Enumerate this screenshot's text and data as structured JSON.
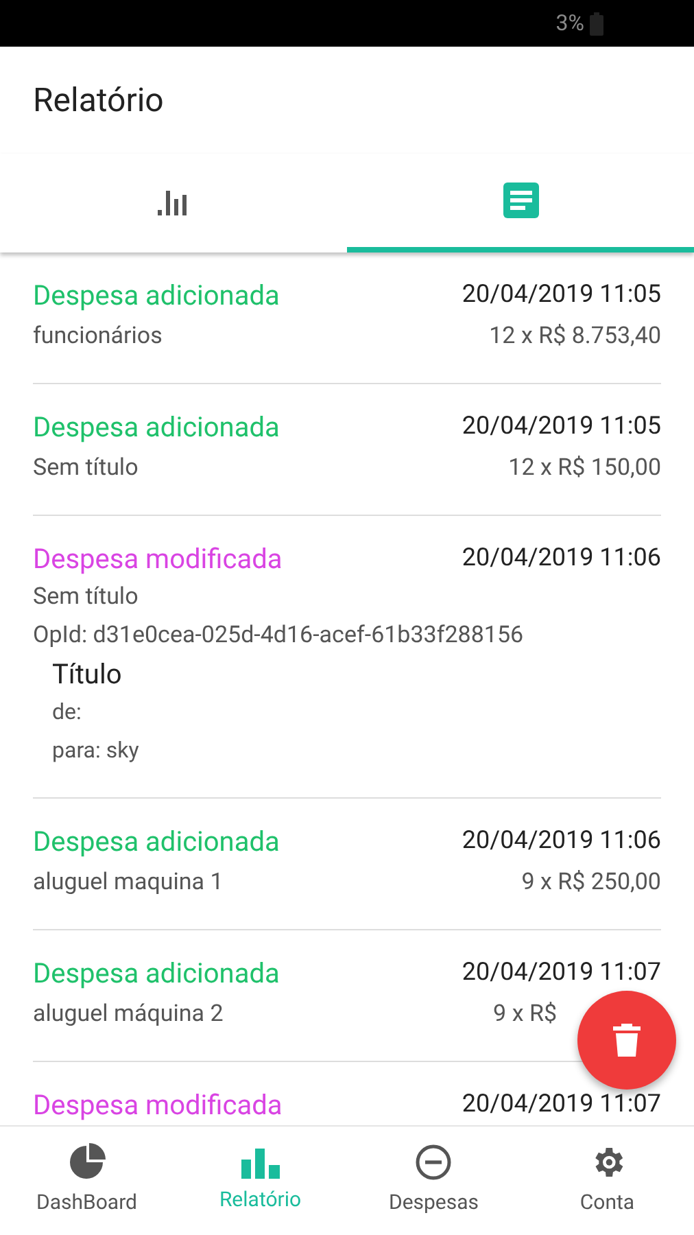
{
  "status_bar": {
    "battery": "3%"
  },
  "app_bar": {
    "title": "Relatório"
  },
  "tabs": [
    {
      "kind": "chart",
      "selected": false
    },
    {
      "kind": "list",
      "selected": true
    }
  ],
  "entries": [
    {
      "kind": "added",
      "title": "Despesa adicionada",
      "date": "20/04/2019 11:05",
      "subtitle": "funcionários",
      "amount": "12 x R$ 8.753,40"
    },
    {
      "kind": "added",
      "title": "Despesa adicionada",
      "date": "20/04/2019 11:05",
      "subtitle": "Sem título",
      "amount": "12 x R$ 150,00"
    },
    {
      "kind": "modified",
      "title": "Despesa modificada",
      "date": "20/04/2019 11:06",
      "subtitle": "Sem título",
      "op_id": "OpId: d31e0cea-025d-4d16-acef-61b33f288156",
      "change": {
        "field": "Título",
        "from": "de:",
        "to": "para: sky"
      }
    },
    {
      "kind": "added",
      "title": "Despesa adicionada",
      "date": "20/04/2019 11:06",
      "subtitle": "aluguel maquina 1",
      "amount": "9 x R$ 250,00"
    },
    {
      "kind": "added",
      "title": "Despesa adicionada",
      "date": "20/04/2019 11:07",
      "subtitle": "aluguel máquina 2",
      "amount": "9 x R$",
      "covered_by_button": true
    },
    {
      "kind": "modified",
      "title": "Despesa modificada",
      "date": "20/04/2019 11:07"
    }
  ],
  "bottom_nav": [
    {
      "kind": "dashboard",
      "label": "DashBoard",
      "selected": false
    },
    {
      "kind": "report",
      "label": "Relatório",
      "selected": true
    },
    {
      "kind": "expenses",
      "label": "Despesas",
      "selected": false
    },
    {
      "kind": "account",
      "label": "Conta",
      "selected": false
    }
  ]
}
